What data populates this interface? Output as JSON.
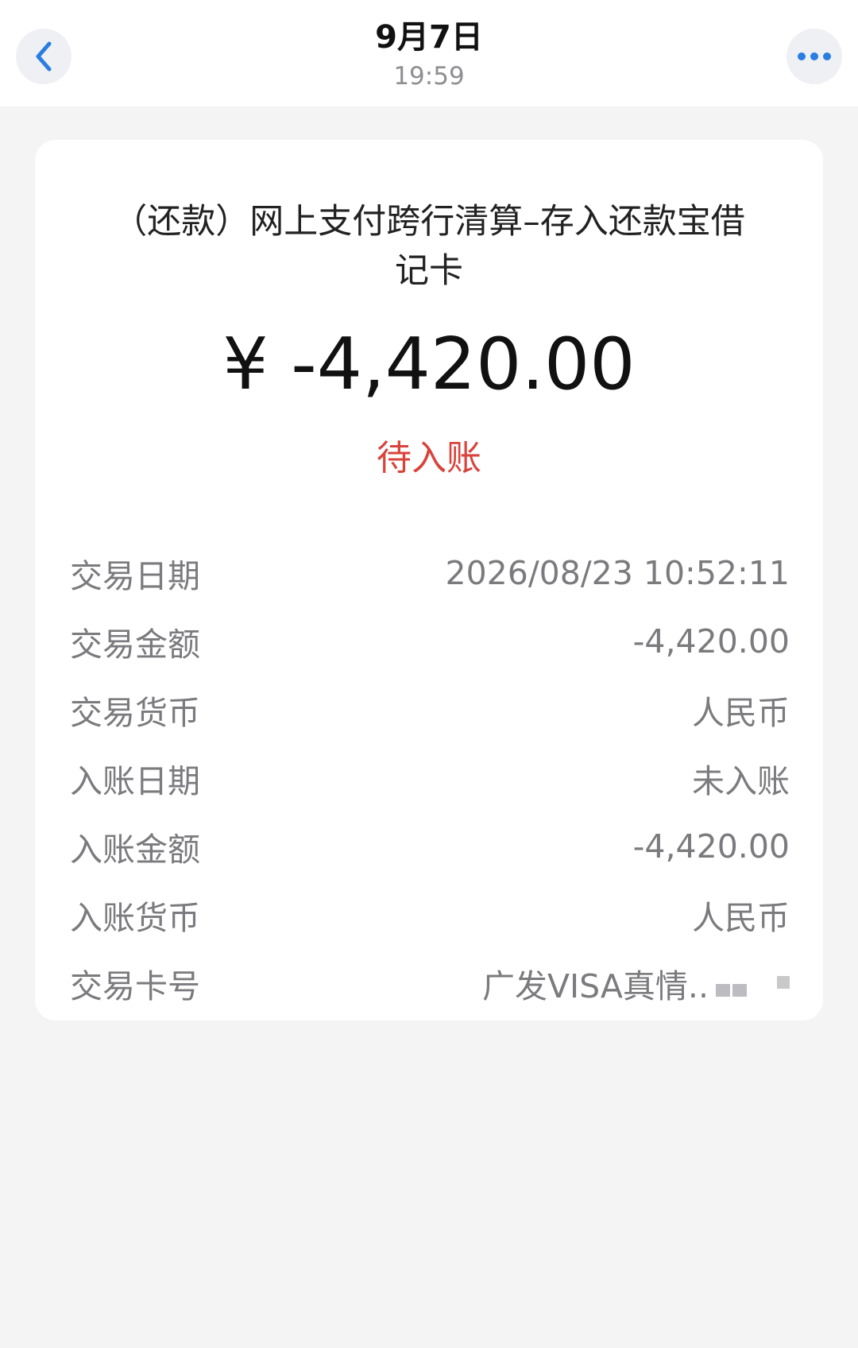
{
  "header": {
    "date": "9月7日",
    "time": "19:59",
    "back_icon": "chevron-left-icon",
    "more_icon": "more-horizontal-icon",
    "accent_color": "#2a7de1"
  },
  "transaction": {
    "description": "（还款）网上支付跨行清算–存入还款宝借记卡",
    "amount": "¥ -4,420.00",
    "status": "待入账",
    "status_color": "#d8443c"
  },
  "details": [
    {
      "label": "交易日期",
      "value": "2026/08/23 10:52:11"
    },
    {
      "label": "交易金额",
      "value": "-4,420.00"
    },
    {
      "label": "交易货币",
      "value": "人民币"
    },
    {
      "label": "入账日期",
      "value": "未入账"
    },
    {
      "label": "入账金额",
      "value": "-4,420.00"
    },
    {
      "label": "入账货币",
      "value": "人民币"
    },
    {
      "label": "交易卡号",
      "value": "广发VISA真情.."
    }
  ]
}
